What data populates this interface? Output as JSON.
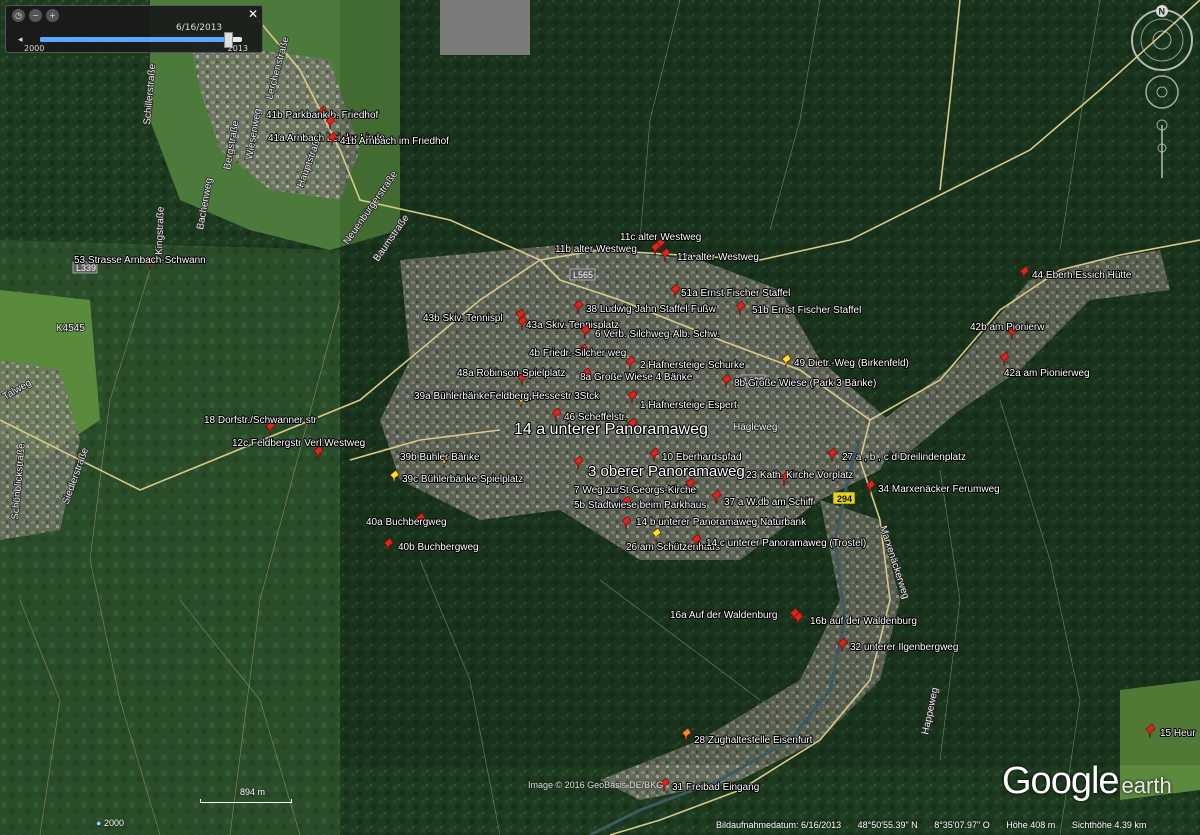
{
  "time_slider": {
    "date": "6/16/2013",
    "year_start": "2000",
    "year_end": "2013",
    "position_fraction": 0.93
  },
  "history_year": "2000",
  "scale_label": "894 m",
  "image_credit": "Image © 2016 GeoBasis-DE/BKG",
  "logo": {
    "main": "Google",
    "suffix": "earth"
  },
  "status": {
    "date": "Bildaufnahmedatum: 6/16/2013",
    "lat": "48°50'55.39\" N",
    "lon": "8°35'07.97\" O",
    "elev": "Höhe  408 m",
    "eye": "Sichthöhe  4.39 km"
  },
  "compass_letter": "N",
  "road_badges": {
    "l339": "L339",
    "l565": "L565",
    "l339b": "L339",
    "b294": "294",
    "k4545": "K4545"
  },
  "roads": {
    "kingstrasse": "Kingstraße",
    "schillerstrasse": "Schillerstraße",
    "lerchenstrasse": "Lerchenstraße",
    "bergstrasse": "Bergstraße",
    "wiesenweg": "Wiesenweg",
    "hauptstrasse": "Hauptstraße",
    "bachenweg": "Bachenweg",
    "neuenbuergerstrasse": "Neuenbürgerstraße",
    "baumstrasse": "Baumstraße",
    "haegleweg": "Hägleweg",
    "marxenaeckerweg": "Marxenäckerweg",
    "happeweg": "Happeweg",
    "talweg": "Talweg",
    "schoenblickstrasse": "Schönblickstraße",
    "siedlerstrasse": "Siedlerstraße"
  },
  "placemarks": [
    {
      "label": "41b Parkbank b. Friedhof",
      "color": "red"
    },
    {
      "label": "41a Arnbach bei der Linde",
      "color": "red"
    },
    {
      "label": "41b Arnbach im Friedhof",
      "color": "red"
    },
    {
      "label": "53 Strasse Arnbach-Schwann",
      "color": "red"
    },
    {
      "label": "11c alter Westweg",
      "color": "red"
    },
    {
      "label": "11b alter Westweg",
      "color": "red"
    },
    {
      "label": "11a alter Westweg",
      "color": "red"
    },
    {
      "label": "51a Ernst Fischer Staffel",
      "color": "red"
    },
    {
      "label": "38  Ludwig-Jahn Staffel-Fußw",
      "color": "red"
    },
    {
      "label": "51b Ernst Fischer Staffel",
      "color": "red"
    },
    {
      "label": "43b Skiv. Tennispl",
      "color": "red"
    },
    {
      "label": "43a Skiv. Tennisplatz",
      "color": "red"
    },
    {
      "label": "6  Verb. Silchweg-Alb. Schw.",
      "color": "red"
    },
    {
      "label": "4b Friedr.-Silcher weg",
      "color": "red"
    },
    {
      "label": "49 Dietr.-Weg (Birkenfeld)",
      "color": "yellow"
    },
    {
      "label": "2 Hafnersteige Schurke",
      "color": "red"
    },
    {
      "label": "48a Robinson-Spielplatz",
      "color": "red"
    },
    {
      "label": "8a Große Wiese 4 Bänke",
      "color": "red"
    },
    {
      "label": "8b Große  Wiese (Park 3 Bänke)",
      "color": "red"
    },
    {
      "label": "39a BühlerbänkeFeldberg,Hessestr 3Stck",
      "color": "yellow"
    },
    {
      "label": "1 Hafnersteige Espert",
      "color": "red"
    },
    {
      "label": "46 Scheffelstr.",
      "color": "red"
    },
    {
      "label": "14 a unterer Panoramaweg",
      "color": "red"
    },
    {
      "label": "18 Dorfstr./Schwanner str",
      "color": "red"
    },
    {
      "label": "12c Feldbergstr Verl.Westweg",
      "color": "red"
    },
    {
      "label": "39b Bühler Bänke",
      "color": "yellow"
    },
    {
      "label": "39c Bühlerbänke Spielplatz",
      "color": "yellow"
    },
    {
      "label": "3 oberer Panoramaweg",
      "color": "red"
    },
    {
      "label": "10 Eberhardspfad",
      "color": "red"
    },
    {
      "label": "27 a , b , c d Dreilindenplatz",
      "color": "red"
    },
    {
      "label": "23 Kath. Kirche Vorplatz",
      "color": "red"
    },
    {
      "label": "34 Marxenäcker Ferumweg",
      "color": "red"
    },
    {
      "label": "7 Weg zurSt.Georgs-Kirche",
      "color": "red"
    },
    {
      "label": "37 a W.db  am Schiff",
      "color": "red"
    },
    {
      "label": "5b Stadtwiese beim Parkhaus",
      "color": "red"
    },
    {
      "label": "40a Buchbergweg",
      "color": "red"
    },
    {
      "label": "14 b unterer Panoramaweg Naturbank",
      "color": "red"
    },
    {
      "label": "40b Buchbergweg",
      "color": "red"
    },
    {
      "label": "26 am Schützenhaus",
      "color": "yellow"
    },
    {
      "label": "14 c unterer Panoramaweg (Trostel)",
      "color": "red"
    },
    {
      "label": "44  Eberh.Essich Hütte",
      "color": "red"
    },
    {
      "label": "42b am Pionierw",
      "color": "red"
    },
    {
      "label": "42a am Pionierweg",
      "color": "red"
    },
    {
      "label": "16a Auf der Waldenburg",
      "color": "red"
    },
    {
      "label": "16b auf der Waldenburg",
      "color": "red"
    },
    {
      "label": "32 unterer Ilgenbergweg",
      "color": "red"
    },
    {
      "label": "28 Zughaltestelle Eisenfurt",
      "color": "orange"
    },
    {
      "label": "31 Freibad Eingang",
      "color": "red"
    },
    {
      "label": "15  Heur",
      "color": "red"
    }
  ]
}
